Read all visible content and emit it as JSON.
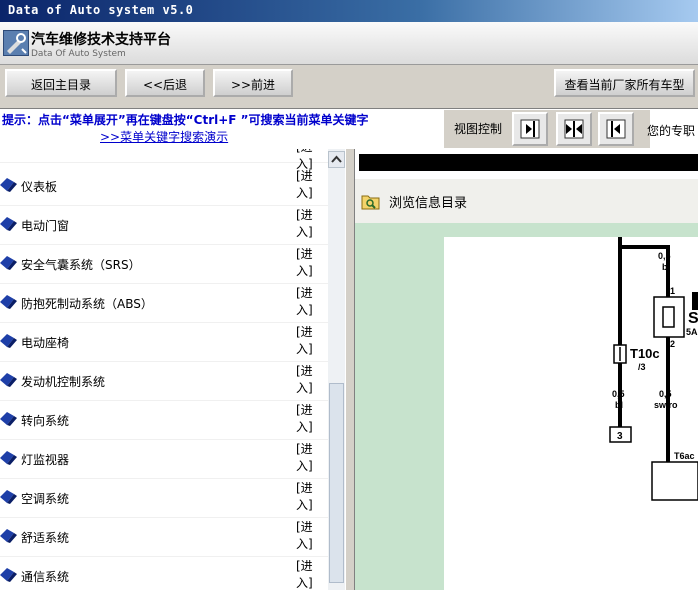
{
  "window": {
    "title": "Data of Auto system v5.0"
  },
  "header": {
    "title": "汽车维修技术支持平台",
    "subtitle": "Data Of Auto System"
  },
  "toolbar": {
    "back_main": "返回主目录",
    "back": "<<后退",
    "forward": ">>前进",
    "all_models": "查看当前厂家所有车型"
  },
  "hint": {
    "text": "提示：点击“菜单展开”再在键盘按“Ctrl+F ”可搜索当前菜单关键字",
    "demo_link": ">>菜单关键字搜索演示"
  },
  "view_control": {
    "label": "视图控制"
  },
  "specialist": "您的专职",
  "menu": {
    "link_label": "[进入]",
    "items": [
      {
        "label": "仪表板"
      },
      {
        "label": "电动门窗"
      },
      {
        "label": "安全气囊系统（SRS）"
      },
      {
        "label": "防抱死制动系统（ABS）"
      },
      {
        "label": "电动座椅"
      },
      {
        "label": "发动机控制系统"
      },
      {
        "label": "转向系统"
      },
      {
        "label": "灯监视器"
      },
      {
        "label": "空调系统"
      },
      {
        "label": "舒适系统"
      },
      {
        "label": "通信系统"
      }
    ]
  },
  "browser": {
    "title": "浏览信息目录"
  },
  "diagram": {
    "wire1": "0,5",
    "wire1_color": "bl",
    "pin1": "1",
    "pin2": "2",
    "fuse_label": "S",
    "fuse_rating": "5A",
    "connector": "T10c",
    "connector_pin": "/3",
    "wire2": "0,5",
    "wire2_color": "bl",
    "wire3": "0,5",
    "wire3_color": "sw/ro",
    "ground": "3",
    "t_label": "T6ac"
  },
  "colors": {
    "hint_text": "#0000cc",
    "diagram_bg": "#c7e3cd",
    "menu_icon": "#1e3fa8"
  }
}
